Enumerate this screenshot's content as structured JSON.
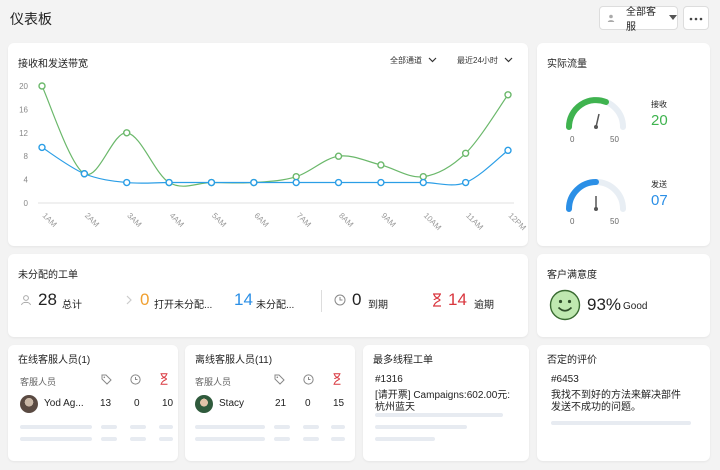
{
  "header": {
    "title": "仪表板",
    "agent_filter": "全部客服"
  },
  "bandwidth": {
    "title": "接收和发送带宽",
    "channel_filter": "全部通道",
    "time_filter": "最近24小时"
  },
  "chart_data": {
    "type": "line",
    "categories": [
      "1AM",
      "2AM",
      "3AM",
      "4AM",
      "5AM",
      "6AM",
      "7AM",
      "8AM",
      "9AM",
      "10AM",
      "11AM",
      "12PM"
    ],
    "ylim": [
      0,
      20
    ],
    "yticks": [
      "0",
      "4",
      "8",
      "12",
      "16",
      "20"
    ],
    "series": [
      {
        "color": "#6bb86b",
        "values": [
          20,
          5,
          12,
          3.5,
          3.5,
          3.5,
          4.5,
          8,
          6.5,
          4.5,
          8.5,
          18.5
        ]
      },
      {
        "color": "#2b9ee6",
        "values": [
          9.5,
          5,
          3.5,
          3.5,
          3.5,
          3.5,
          3.5,
          3.5,
          3.5,
          3.5,
          3.5,
          9
        ]
      }
    ]
  },
  "traffic": {
    "title": "实际流量",
    "received": {
      "label": "接收",
      "value": "20",
      "min": "0",
      "max": "50",
      "color": "#3fb34f"
    },
    "sent": {
      "label": "发送",
      "value": "07",
      "min": "0",
      "max": "50",
      "color": "#2b8fe6"
    }
  },
  "unassigned": {
    "title": "未分配的工单",
    "total": {
      "value": "28",
      "label": "总计"
    },
    "open": {
      "value": "0",
      "label": "打开未分配...",
      "color": "#f0a030"
    },
    "unassigned": {
      "value": "14",
      "label": "未分配...",
      "color": "#2b8fe6"
    },
    "due": {
      "value": "0",
      "label": "到期"
    },
    "overdue": {
      "value": "14",
      "label": "逾期",
      "color": "#d9363e"
    }
  },
  "satisfaction": {
    "title": "客户满意度",
    "value": "93%",
    "label": "Good"
  },
  "online_agents": {
    "title": "在线客服人员(1)",
    "column": "客服人员",
    "row": {
      "name": "Yod Ag...",
      "c1": "13",
      "c2": "0",
      "c3": "10"
    }
  },
  "offline_agents": {
    "title": "离线客服人员(11)",
    "column": "客服人员",
    "row": {
      "name": "Stacy",
      "c1": "21",
      "c2": "0",
      "c3": "15"
    }
  },
  "most_threads": {
    "title": "最多线程工单",
    "id": "#1316",
    "text1": "[请开票] Campaigns:602.00元:",
    "text2": "杭州蓝天"
  },
  "negative": {
    "title": "否定的评价",
    "id": "#6453",
    "text1": "我找不到好的方法来解决部件",
    "text2": "发送不成功的问题。"
  }
}
